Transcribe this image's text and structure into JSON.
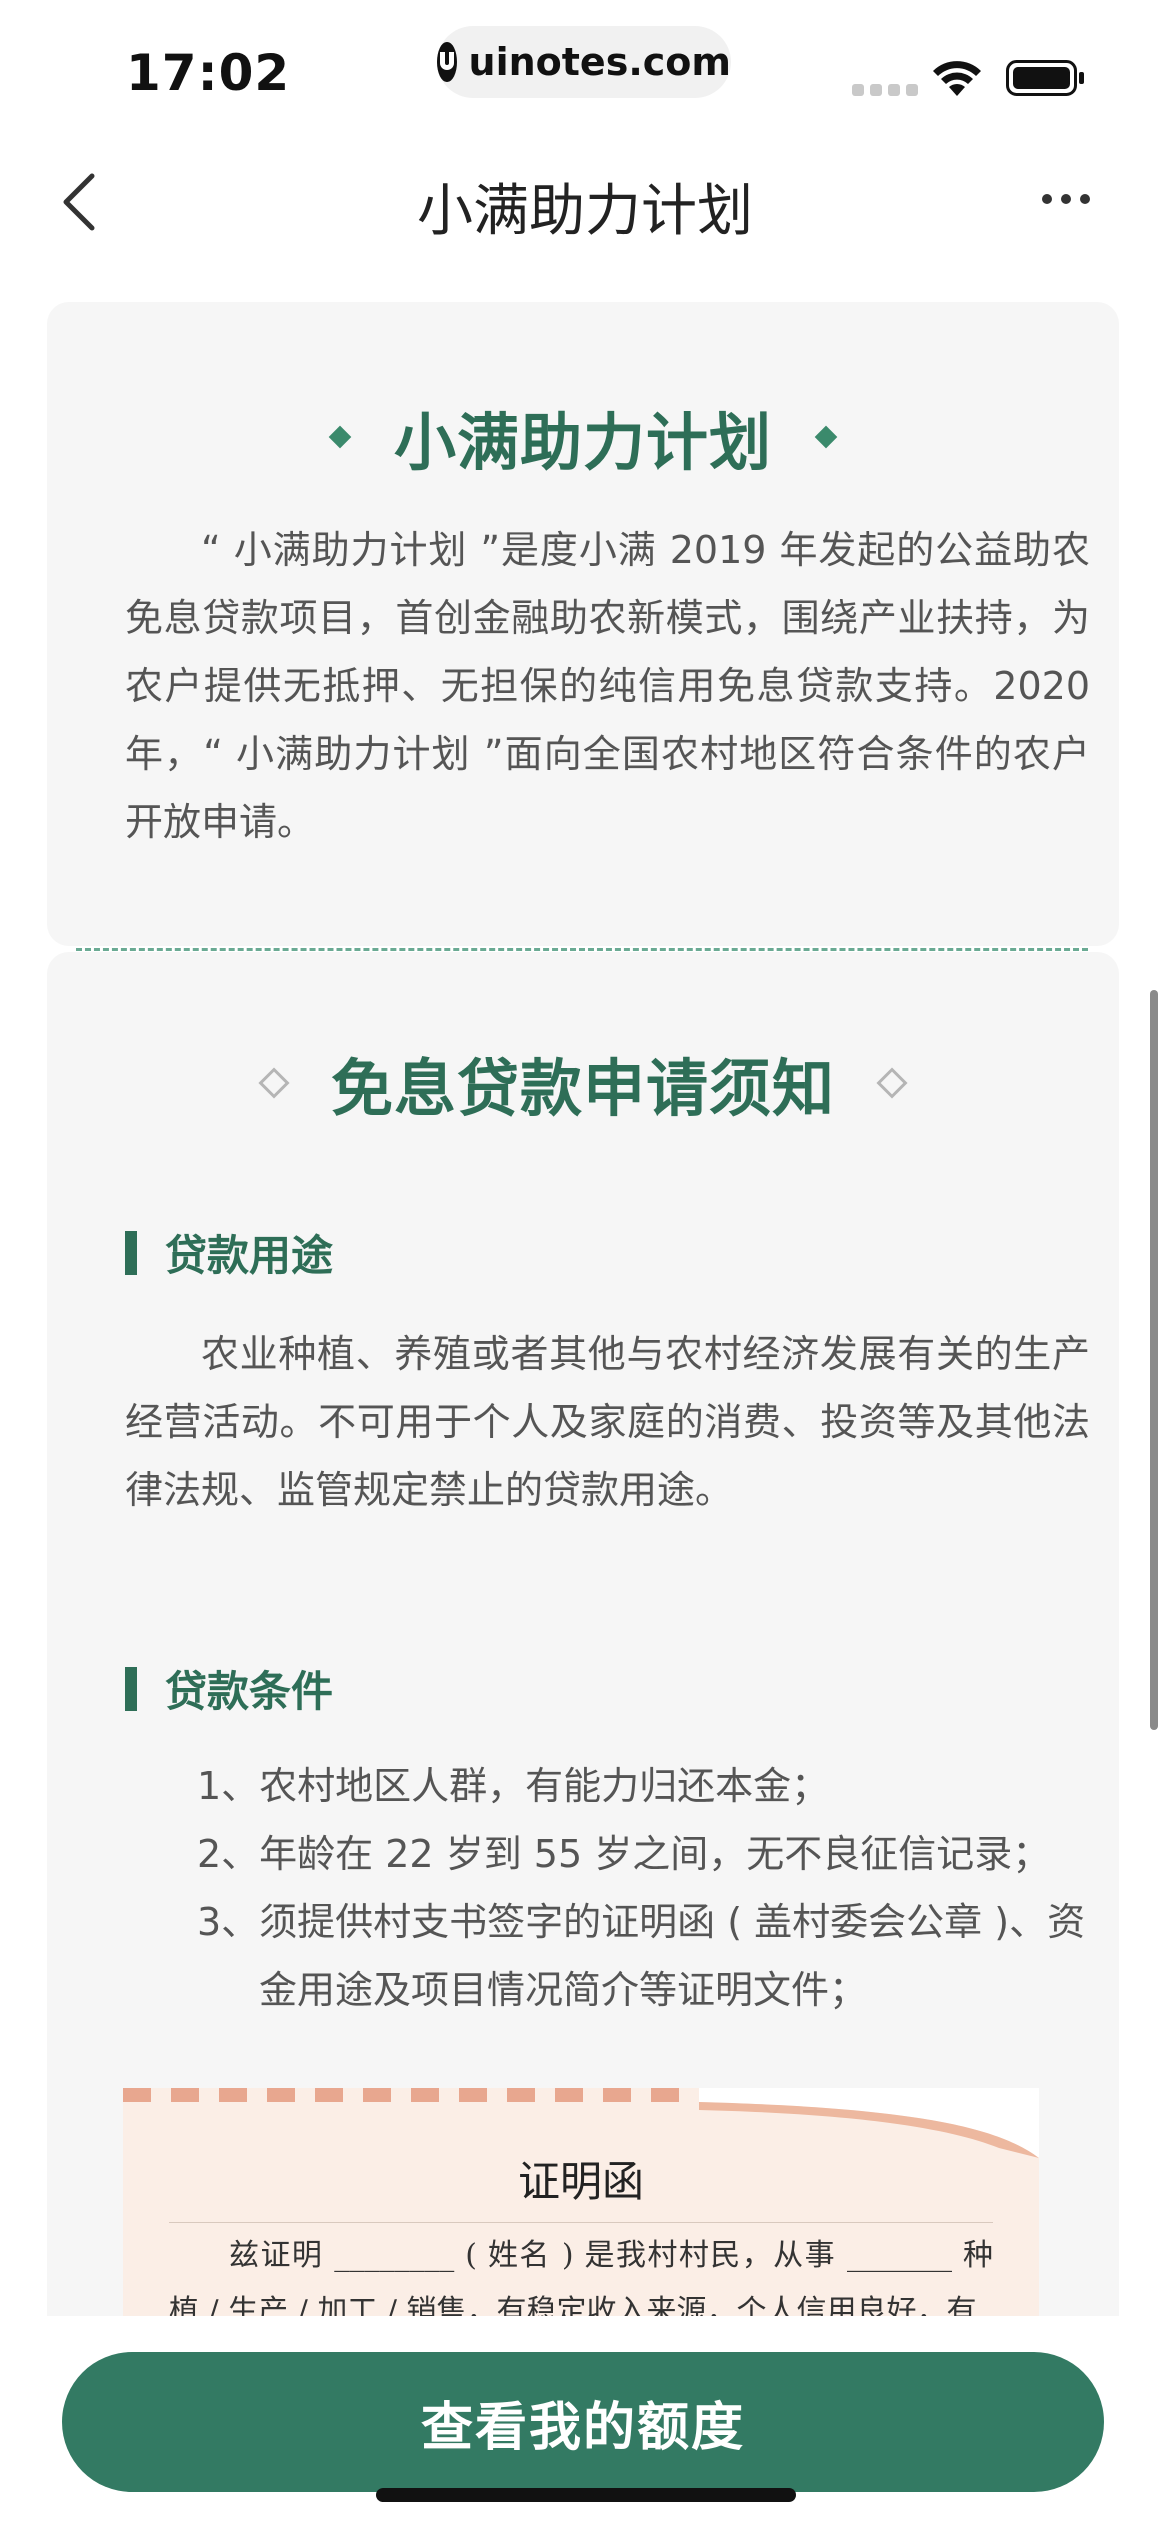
{
  "status_bar": {
    "time": "17:02",
    "url": "uinotes.com"
  },
  "nav": {
    "title": "小满助力计划"
  },
  "intro": {
    "title": "小满助力计划",
    "paragraph": "“ 小满助力计划 ”是度小满 2019 年发起的公益助农免息贷款项目，首创金融助农新模式，围绕产业扶持，为农户提供无抵押、无担保的纯信用免息贷款支持。2020 年，“ 小满助力计划 ”面向全国农村地区符合条件的农户开放申请。"
  },
  "notice": {
    "title": "免息贷款申请须知",
    "usage_heading": "贷款用途",
    "usage_text": "农业种植、养殖或者其他与农村经济发展有关的生产经营活动。不可用于个人及家庭的消费、投资等及其他法律法规、监管规定禁止的贷款用途。",
    "conditions_heading": "贷款条件",
    "conditions": [
      "1、农村地区人群，有能力归还本金；",
      "2、年龄在 22 岁到 55 岁之间，无不良征信记录；",
      "3、须提供村支书签字的证明函 ( 盖村委会公章 )、资金用途及项目情况简介等证明文件；"
    ]
  },
  "certificate": {
    "title": "证明函",
    "text": "兹证明 ________ ( 姓名 ) 是我村村民，从事 _______ 种植 / 生产 / 加工 / 销售，有稳定收入来源，个人信用良好，有"
  },
  "footer": {
    "button_label": "查看我的额度"
  },
  "colors": {
    "brand_green": "#337a63",
    "heading_green": "#2e6e57",
    "card_bg": "#f6f6f6"
  }
}
